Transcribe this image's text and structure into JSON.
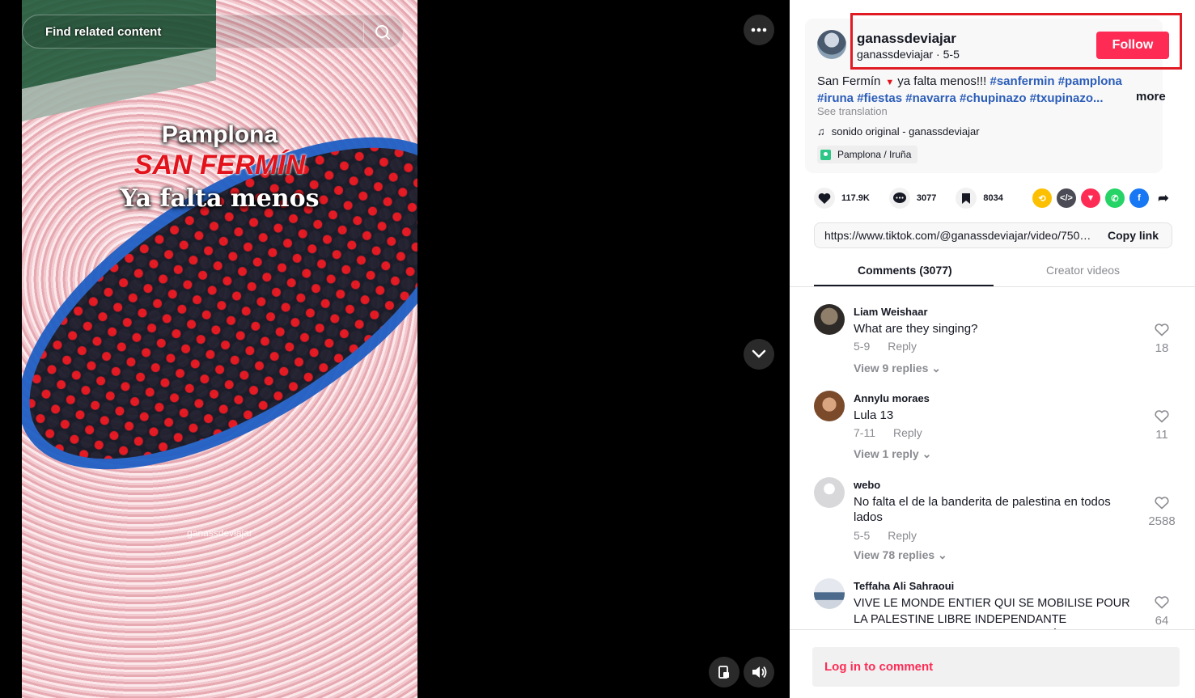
{
  "video": {
    "related_search_placeholder": "Find related content",
    "overlay_line1": "Pamplona",
    "overlay_line2": "SAN FERMÍN",
    "overlay_line3": "Ya falta menos",
    "watermark": "ganassdeviajar"
  },
  "post": {
    "author_name": "ganassdeviajar",
    "author_handle": "ganassdeviajar",
    "author_separator": " · ",
    "post_date": "5-5",
    "follow_label": "Follow",
    "description_text": "San Fermín",
    "description_text2": "ya falta menos!!!",
    "hashtags_line1": [
      "#sanfermin",
      "#pamplona"
    ],
    "hashtags_line2": [
      "#iruna",
      "#fiestas",
      "#navarra",
      "#chupinazo",
      "#txupinazo..."
    ],
    "more_label": "more",
    "see_translation": "See translation",
    "sound": "sonido original - ganassdeviajar",
    "location": "Pamplona / Iruña"
  },
  "actions": {
    "likes": "117.9K",
    "comments": "3077",
    "saves": "8034"
  },
  "share_icons": [
    "repost-icon",
    "embed-icon",
    "send-icon",
    "whatsapp-icon",
    "facebook-icon",
    "share-arrow-icon"
  ],
  "link": {
    "url": "https://www.tiktok.com/@ganassdeviajar/video/7500...",
    "copy_label": "Copy link"
  },
  "tabs": {
    "comments": "Comments (3077)",
    "creator_videos": "Creator videos"
  },
  "comments": [
    {
      "user": "Liam Weishaar",
      "text": "What are they singing?",
      "date": "5-9",
      "reply": "Reply",
      "likes": "18",
      "view_replies": "View 9 replies"
    },
    {
      "user": "Annylu moraes",
      "text": "Lula 13",
      "date": "7-11",
      "reply": "Reply",
      "likes": "11",
      "view_replies": "View 1 reply"
    },
    {
      "user": "webo",
      "text": "No falta el de la banderita de palestina en todos lados",
      "date": "5-5",
      "reply": "Reply",
      "likes": "2588",
      "view_replies": "View 78 replies"
    },
    {
      "user": "Teffaha Ali Sahraoui",
      "text": "VIVE LE MONDE ENTIER QUI SE MOBILISE POUR LA PALESTINE LIBRE INDEPENDANTE INCHALLAH QUE DIEU VOUS PROTÈGES INCHALLAH",
      "likes": "64"
    }
  ],
  "login": {
    "label": "Log in to comment"
  },
  "colors": {
    "accent": "#fe2c55",
    "hashtag": "#2b5db9",
    "highlight": "#e01b24"
  }
}
